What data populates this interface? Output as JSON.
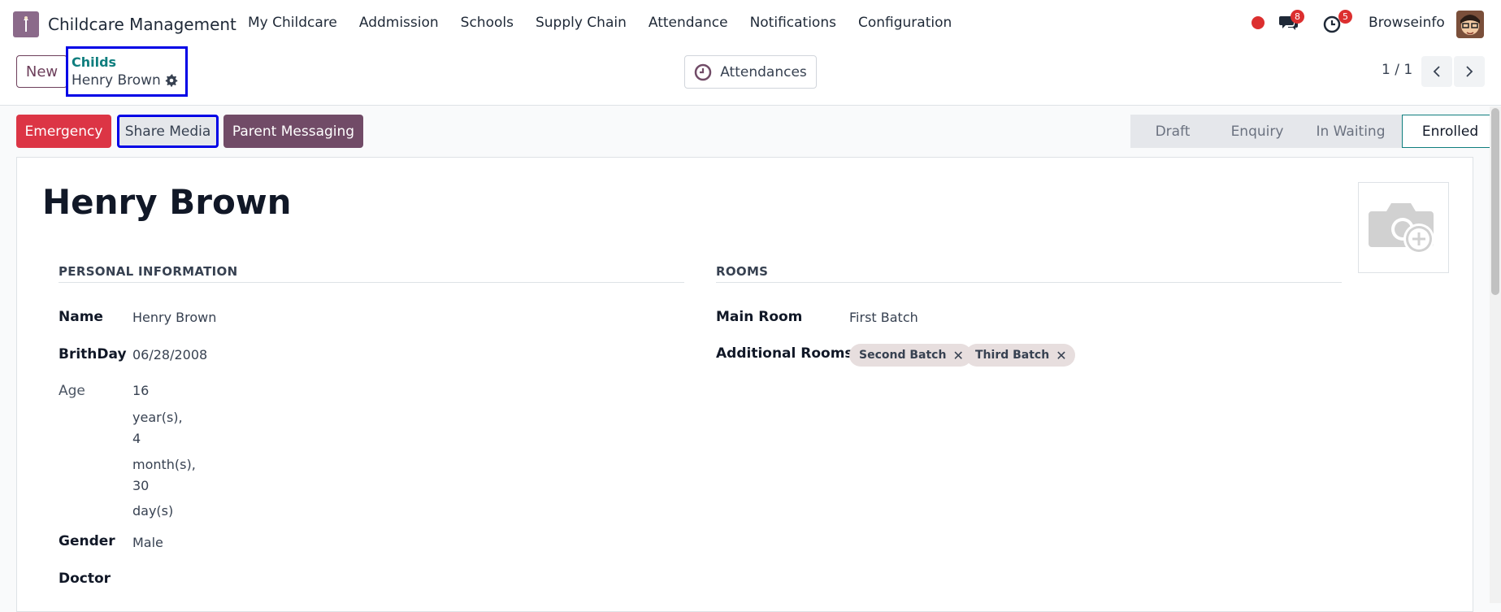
{
  "app": {
    "title": "Childcare Management",
    "company": "Browseinfo"
  },
  "menu": [
    "My Childcare",
    "Addmission",
    "Schools",
    "Supply Chain",
    "Attendance",
    "Notifications",
    "Configuration"
  ],
  "systray": {
    "chat_count": "8",
    "activity_count": "5"
  },
  "control": {
    "new_label": "New",
    "breadcrumb_parent": "Childs",
    "breadcrumb_current": "Henry Brown",
    "attendances_label": "Attendances",
    "pager": "1 / 1"
  },
  "actions": {
    "emergency": "Emergency",
    "share_media": "Share Media",
    "parent_messaging": "Parent Messaging"
  },
  "statusbar": [
    "Draft",
    "Enquiry",
    "In Waiting",
    "Enrolled"
  ],
  "status_active": "Enrolled",
  "record": {
    "name": "Henry Brown",
    "personal_section": "PERSONAL INFORMATION",
    "rooms_section": "ROOMS",
    "fields": {
      "name_label": "Name",
      "name_value": "Henry Brown",
      "birthday_label": "BrithDay",
      "birthday_value": "06/28/2008",
      "age_label": "Age",
      "age_lines": [
        "16",
        "year(s),",
        "4",
        "month(s),",
        "30",
        "day(s)"
      ],
      "gender_label": "Gender",
      "gender_value": "Male",
      "doctor_label": "Doctor",
      "main_room_label": "Main Room",
      "main_room_value": "First Batch",
      "additional_rooms_label": "Additional Rooms",
      "additional_rooms": [
        "Second Batch",
        "Third Batch"
      ]
    }
  },
  "colors": {
    "primary": "#714B67",
    "danger": "#DC3545",
    "teal": "#017E84",
    "highlight": "#0000E6"
  }
}
